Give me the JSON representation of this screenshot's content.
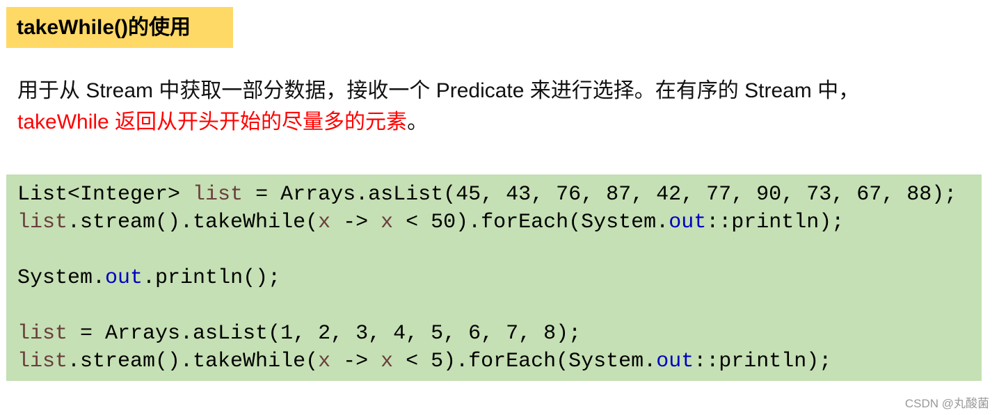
{
  "title": "takeWhile()的使用",
  "description": {
    "text_before": "用于从 Stream 中获取一部分数据，接收一个 Predicate 来进行选择。在有序的 Stream 中，",
    "highlight": "takeWhile 返回从开头开始的尽量多的元素",
    "text_after": "。",
    "highlight_color": "#FF0000"
  },
  "code": {
    "background": "#C5E0B4",
    "lines": [
      [
        {
          "t": "List<Integer> ",
          "k": "plain"
        },
        {
          "t": "list",
          "k": "var"
        },
        {
          "t": " = Arrays.asList(45, 43, 76, 87, 42, 77, 90, 73, 67, 88);",
          "k": "plain"
        }
      ],
      [
        {
          "t": "list",
          "k": "var"
        },
        {
          "t": ".stream().takeWhile(",
          "k": "plain"
        },
        {
          "t": "x",
          "k": "var"
        },
        {
          "t": " -> ",
          "k": "plain"
        },
        {
          "t": "x",
          "k": "var"
        },
        {
          "t": " < 50).forEach(System.",
          "k": "plain"
        },
        {
          "t": "out",
          "k": "field"
        },
        {
          "t": "::println);",
          "k": "plain"
        }
      ],
      [],
      [
        {
          "t": "System.",
          "k": "plain"
        },
        {
          "t": "out",
          "k": "field"
        },
        {
          "t": ".println();",
          "k": "plain"
        }
      ],
      [],
      [
        {
          "t": "list",
          "k": "var"
        },
        {
          "t": " = Arrays.asList(1, 2, 3, 4, 5, 6, 7, 8);",
          "k": "plain"
        }
      ],
      [
        {
          "t": "list",
          "k": "var"
        },
        {
          "t": ".stream().takeWhile(",
          "k": "plain"
        },
        {
          "t": "x",
          "k": "var"
        },
        {
          "t": " -> ",
          "k": "plain"
        },
        {
          "t": "x",
          "k": "var"
        },
        {
          "t": " < 5).forEach(System.",
          "k": "plain"
        },
        {
          "t": "out",
          "k": "field"
        },
        {
          "t": "::println);",
          "k": "plain"
        }
      ]
    ]
  },
  "watermark": "CSDN @丸酸菌"
}
